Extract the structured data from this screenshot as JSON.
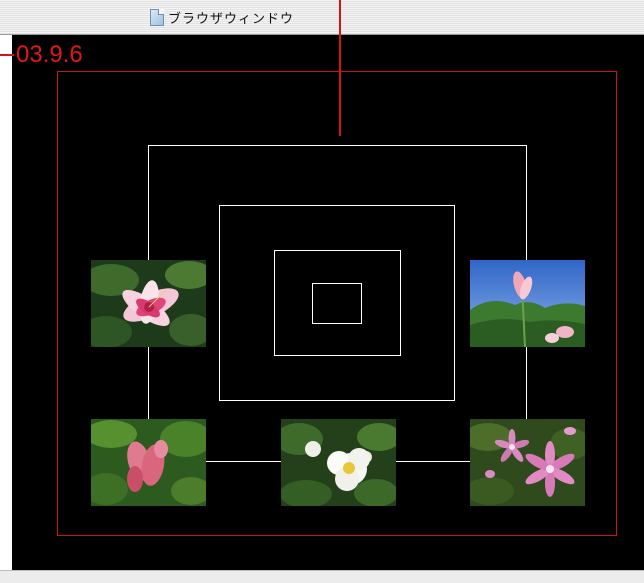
{
  "window": {
    "title": "ブラウザウィンドウ"
  },
  "annotation": {
    "date": "03.9.6"
  },
  "colors": {
    "annotation_red": "#d0161b",
    "background": "#000000",
    "line": "#ffffff"
  },
  "photos": [
    {
      "name": "photo-pink-lily",
      "subject": "pink-white lily"
    },
    {
      "name": "photo-sky-flower",
      "subject": "pink flower against blue sky"
    },
    {
      "name": "photo-pink-bracts",
      "subject": "pink shrimp-like flower"
    },
    {
      "name": "photo-white-rose",
      "subject": "white wild rose"
    },
    {
      "name": "photo-clematis",
      "subject": "pink clematis"
    }
  ]
}
